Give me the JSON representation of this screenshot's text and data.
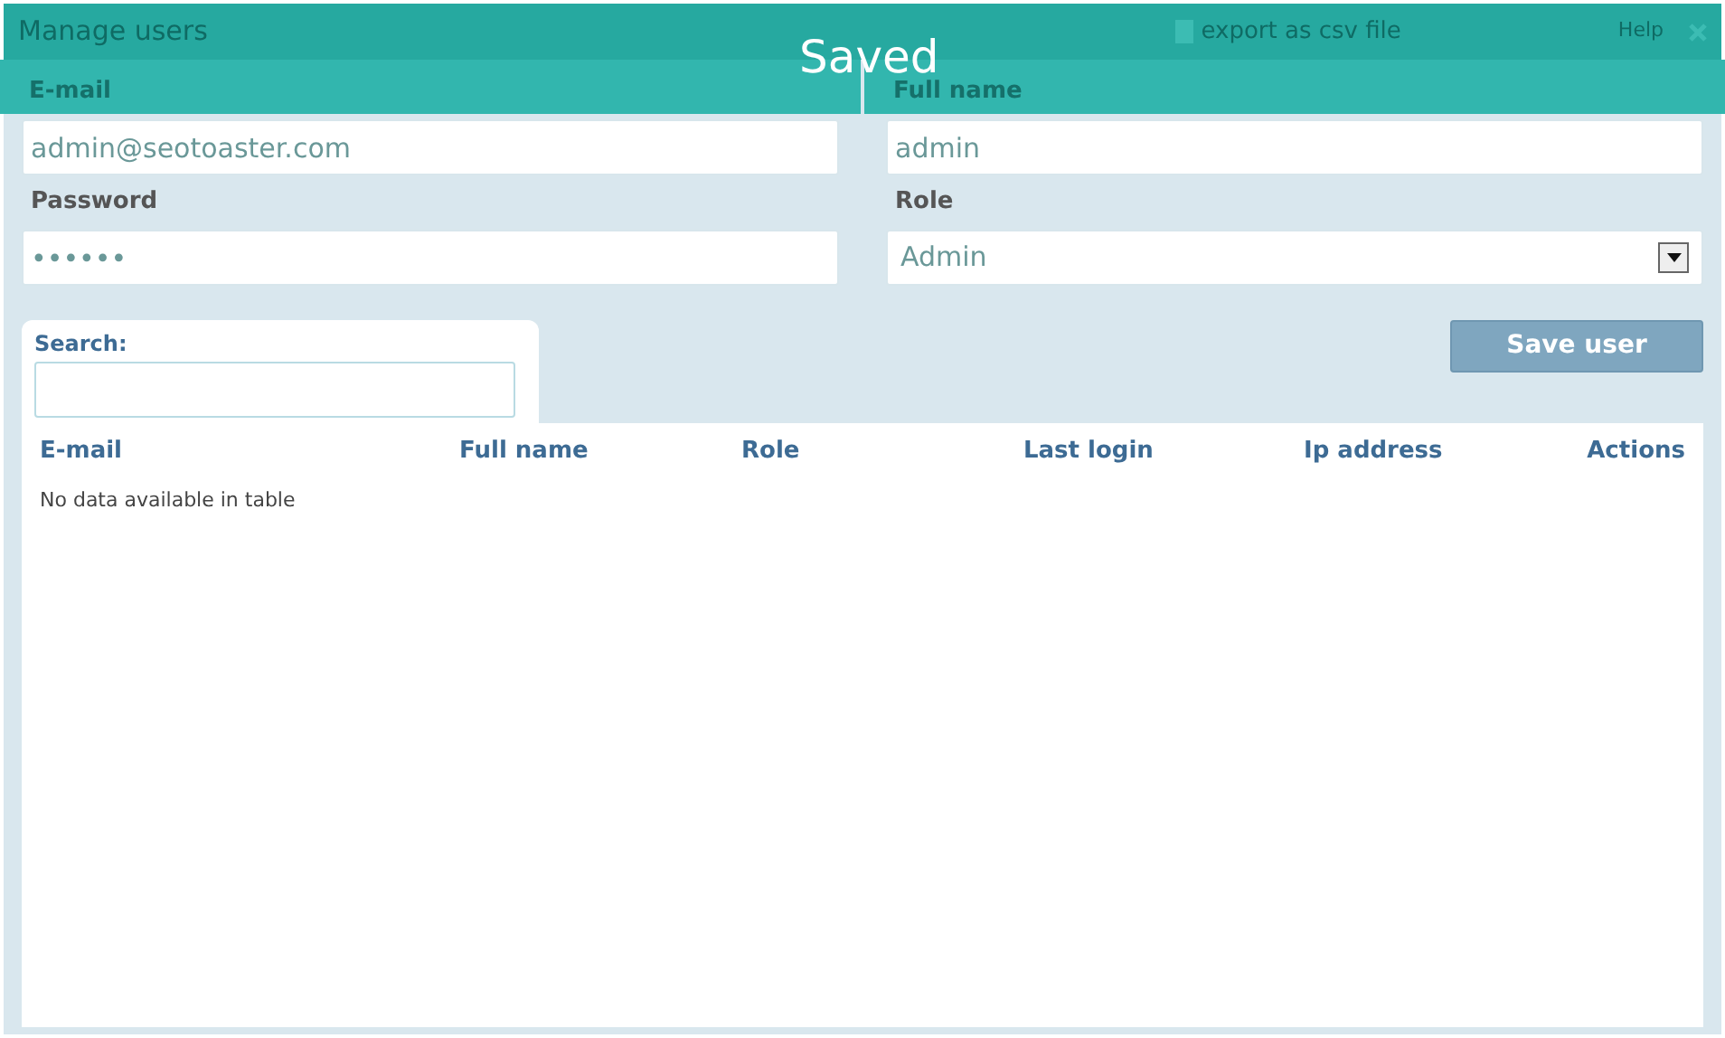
{
  "window": {
    "title": "Manage users",
    "export_link": "export as csv file",
    "help": "Help"
  },
  "notification": {
    "text": "Saved"
  },
  "fields": [
    {
      "label": "E-mail",
      "value": "admin@seotoaster.com",
      "kind": "text"
    },
    {
      "label": "Full name",
      "value": "admin",
      "kind": "text"
    },
    {
      "label": "Password",
      "value": "••••••",
      "kind": "text"
    },
    {
      "label": "Role",
      "value": "Admin",
      "kind": "select"
    }
  ],
  "search": {
    "label": "Search:"
  },
  "save_button": "Save user",
  "table": {
    "columns": [
      "E-mail",
      "Full name",
      "Role",
      "Last login",
      "Ip address",
      "Actions"
    ],
    "empty_message": "No data available in table"
  }
}
